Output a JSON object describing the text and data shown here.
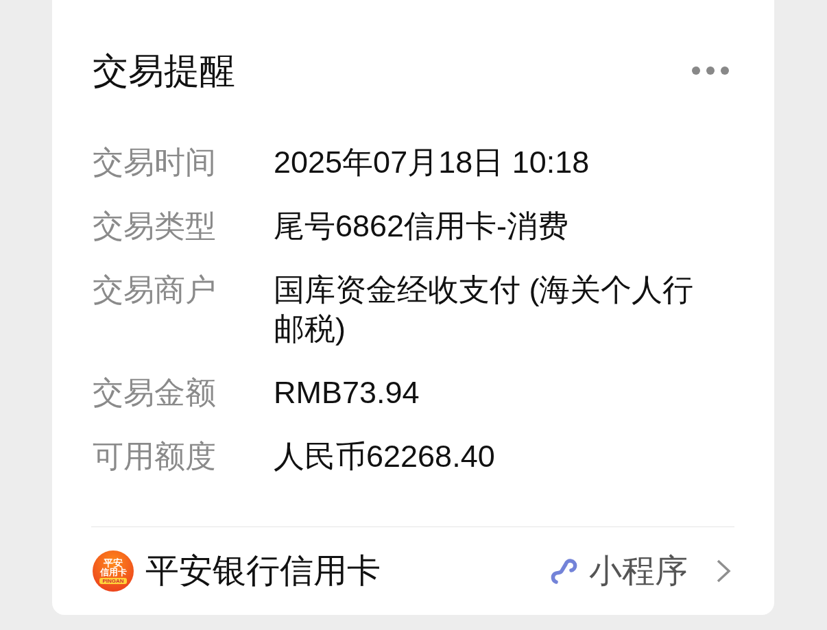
{
  "card": {
    "title": "交易提醒",
    "fields": [
      {
        "label": "交易时间",
        "value": "2025年07月18日 10:18"
      },
      {
        "label": "交易类型",
        "value": "尾号6862信用卡-消费"
      },
      {
        "label": "交易商户",
        "value": "国库资金经收支付 (海关个人行邮税)"
      },
      {
        "label": "交易金额",
        "value": "RMB73.94"
      },
      {
        "label": "可用额度",
        "value": "人民币62268.40"
      }
    ],
    "footer": {
      "logo": {
        "line_1": "平安",
        "line_2": "信用卡",
        "caption": "PINGAN"
      },
      "name": "平安银行信用卡",
      "tag": "小程序"
    }
  }
}
